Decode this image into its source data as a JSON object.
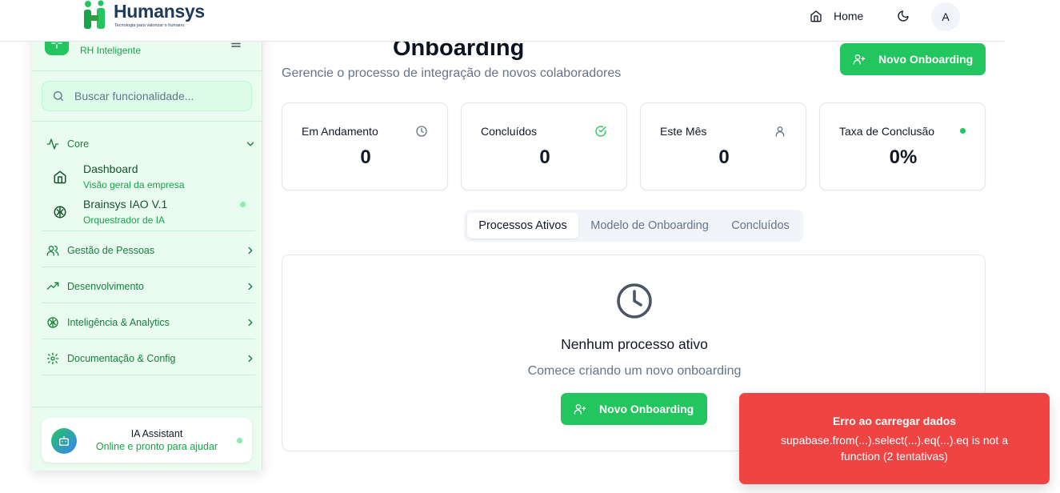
{
  "brand": {
    "name": "Humansys",
    "tagline": "Tecnologia para valorizar o humano.",
    "colors": {
      "green": "#22c55e",
      "navy": "#1f3b57",
      "toast_red": "#ef4444"
    }
  },
  "topnav": {
    "home_label": "Home",
    "avatar_initial": "A",
    "icons": [
      "home-icon",
      "moon-icon"
    ]
  },
  "sidebar": {
    "app_subtitle": "RH Inteligente",
    "search_placeholder": "Buscar funcionalidade...",
    "core": {
      "label": "Core",
      "items": [
        {
          "title": "Dashboard",
          "desc": "Visão geral da empresa",
          "icon": "home-icon"
        },
        {
          "title": "Brainsys IAO V.1",
          "desc": "Orquestrador de IA",
          "icon": "brain-icon"
        }
      ]
    },
    "sections": [
      {
        "label": "Gestão de Pessoas",
        "icon": "users-icon"
      },
      {
        "label": "Desenvolvimento",
        "icon": "trending-up-icon"
      },
      {
        "label": "Inteligência & Analytics",
        "icon": "brain-icon"
      },
      {
        "label": "Documentação & Config",
        "icon": "settings-icon"
      }
    ],
    "assistant": {
      "title": "IA Assistant",
      "subtitle": "Online e pronto para ajudar"
    }
  },
  "main": {
    "title": "Onboarding",
    "subtitle": "Gerencie o processo de integração de novos colaboradores",
    "new_button": "Novo Onboarding",
    "stats": [
      {
        "label": "Em Andamento",
        "value": "0",
        "icon": "clock-icon"
      },
      {
        "label": "Concluídos",
        "value": "0",
        "icon": "check-circle-icon"
      },
      {
        "label": "Este Mês",
        "value": "0",
        "icon": "user-icon"
      },
      {
        "label": "Taxa de Conclusão",
        "value": "0%",
        "icon": "status-dot"
      }
    ],
    "tabs": [
      "Processos Ativos",
      "Modelo de Onboarding",
      "Concluídos"
    ],
    "active_tab": "Processos Ativos",
    "empty": {
      "title": "Nenhum processo ativo",
      "subtitle": "Comece criando um novo onboarding",
      "button": "Novo Onboarding"
    }
  },
  "toast": {
    "title": "Erro ao carregar dados",
    "message": "supabase.from(...).select(...).eq(...).eq is not a function (2 tentativas)"
  }
}
